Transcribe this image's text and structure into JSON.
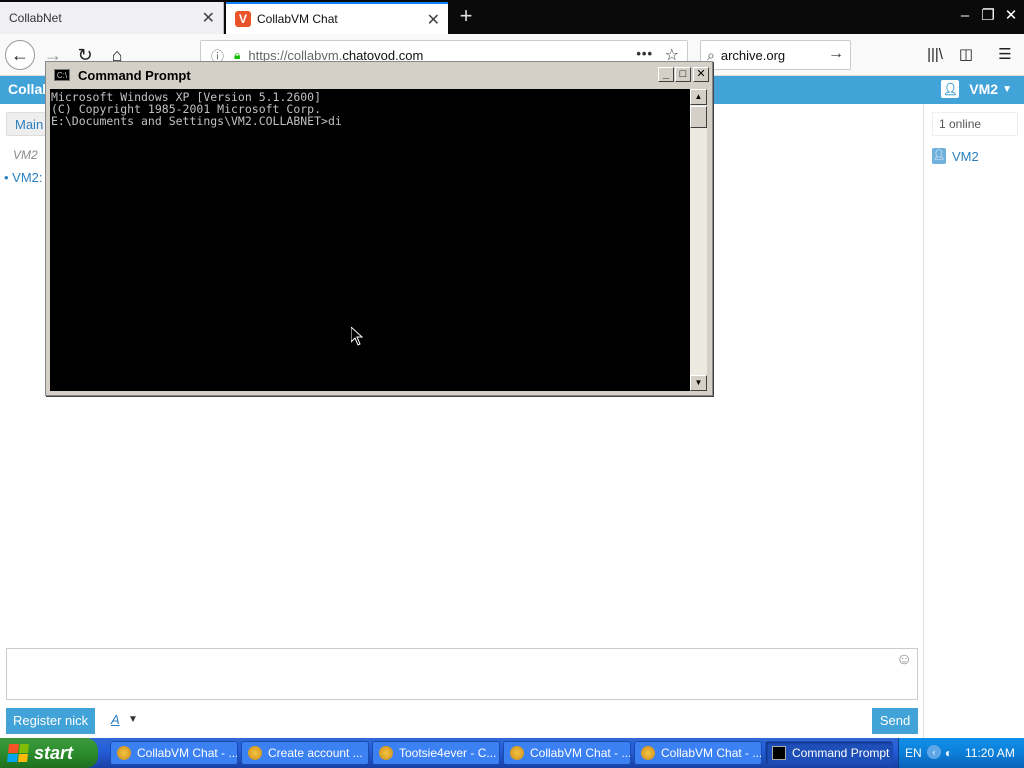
{
  "browser": {
    "tabs": [
      {
        "label": "CollabNet",
        "active": false
      },
      {
        "label": "CollabVM Chat",
        "active": true
      }
    ],
    "url": {
      "prefix": "https://collabvm.",
      "host": "chatovod.com"
    },
    "search_value": "archive.org"
  },
  "page": {
    "brand": "Collab",
    "user_menu": "VM2",
    "main_tab": "Main",
    "vm_label": "VM2",
    "vm_link": "• VM2:",
    "online_count": "1 online",
    "online_users": [
      "VM2"
    ],
    "register_button": "Register nick",
    "format_button": "A",
    "send_button": "Send"
  },
  "cmd": {
    "title": "Command Prompt",
    "lines": [
      "Microsoft Windows XP [Version 5.1.2600]",
      "(C) Copyright 1985-2001 Microsoft Corp.",
      "",
      "E:\\Documents and Settings\\VM2.COLLABNET>di"
    ]
  },
  "taskbar": {
    "start_label": "start",
    "tasks": [
      {
        "label": "CollabVM Chat - ...",
        "icon": "vm-icon",
        "active": false
      },
      {
        "label": "Create account ...",
        "icon": "vm-icon",
        "active": false
      },
      {
        "label": "Tootsie4ever - C...",
        "icon": "vm-icon",
        "active": false
      },
      {
        "label": "CollabVM Chat - ...",
        "icon": "vm-icon",
        "active": false
      },
      {
        "label": "CollabVM Chat - ...",
        "icon": "vm-icon",
        "active": false
      },
      {
        "label": "Command Prompt",
        "icon": "cmd-icon",
        "active": true
      }
    ],
    "language": "EN",
    "clock": "11:20 AM"
  },
  "colors": {
    "accent": "#41a3d8",
    "link": "#2a7fbf",
    "console_bg": "#000000",
    "console_text": "#c0c0c0",
    "taskbar": "#245edb"
  }
}
